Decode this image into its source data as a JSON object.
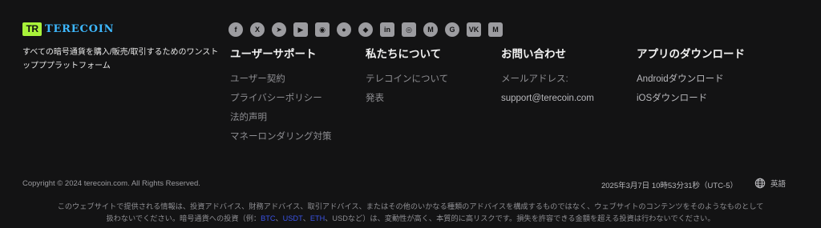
{
  "brand": {
    "mark": "TR",
    "name": "TERECOIN",
    "tagline": "すべての暗号通貨を購入/販売/取引するためのワンストップププラットフォーム"
  },
  "socials": [
    {
      "name": "facebook",
      "glyph": "f"
    },
    {
      "name": "x",
      "glyph": "X"
    },
    {
      "name": "telegram",
      "glyph": "➤"
    },
    {
      "name": "youtube",
      "glyph": "▶"
    },
    {
      "name": "discord",
      "glyph": "◉"
    },
    {
      "name": "reddit",
      "glyph": "●"
    },
    {
      "name": "github",
      "glyph": "◆"
    },
    {
      "name": "linkedin",
      "glyph": "in"
    },
    {
      "name": "instagram",
      "glyph": "◎"
    },
    {
      "name": "coinmarketcap",
      "glyph": "M"
    },
    {
      "name": "coingecko",
      "glyph": "G"
    },
    {
      "name": "vk",
      "glyph": "VK"
    },
    {
      "name": "medium",
      "glyph": "M"
    }
  ],
  "columns": {
    "support": {
      "title": "ユーザーサポート",
      "links": [
        "ユーザー契約",
        "プライバシーポリシー",
        "法的声明",
        "マネーロンダリング対策"
      ]
    },
    "about": {
      "title": "私たちについて",
      "links": [
        "テレコインについて",
        "発表"
      ]
    },
    "contact": {
      "title": "お問い合わせ",
      "email_label": "メールアドレス:",
      "email": "support@terecoin.com"
    },
    "app": {
      "title": "アプリのダウンロード",
      "links": [
        "Androidダウンロード",
        "iOSダウンロード"
      ]
    }
  },
  "footer": {
    "copyright": "Copyright © 2024 terecoin.com. All Rights Reserved.",
    "datetime": "2025年3月7日 10時53分31秒（UTC-5）",
    "language": "英語"
  },
  "disclaimer": {
    "line1": "このウェブサイトで提供される情報は、投資アドバイス、財務アドバイス、取引アドバイス、またはその他のいかなる種類のアドバイスを構成するものではなく、ウェブサイトのコンテンツをそのようなものとして",
    "line2_a": "扱わないでください。暗号通貨への投資（例：",
    "btc": "BTC",
    "sep1": "、",
    "usdt": "USDT",
    "sep2": "、",
    "eth": "ETH",
    "line2_b": "、USDなど）は、変動性が高く、本質的に高リスクです。損失を許容できる金額を超える投資は行わないでください。",
    "accent_color": "#3a53e8"
  }
}
